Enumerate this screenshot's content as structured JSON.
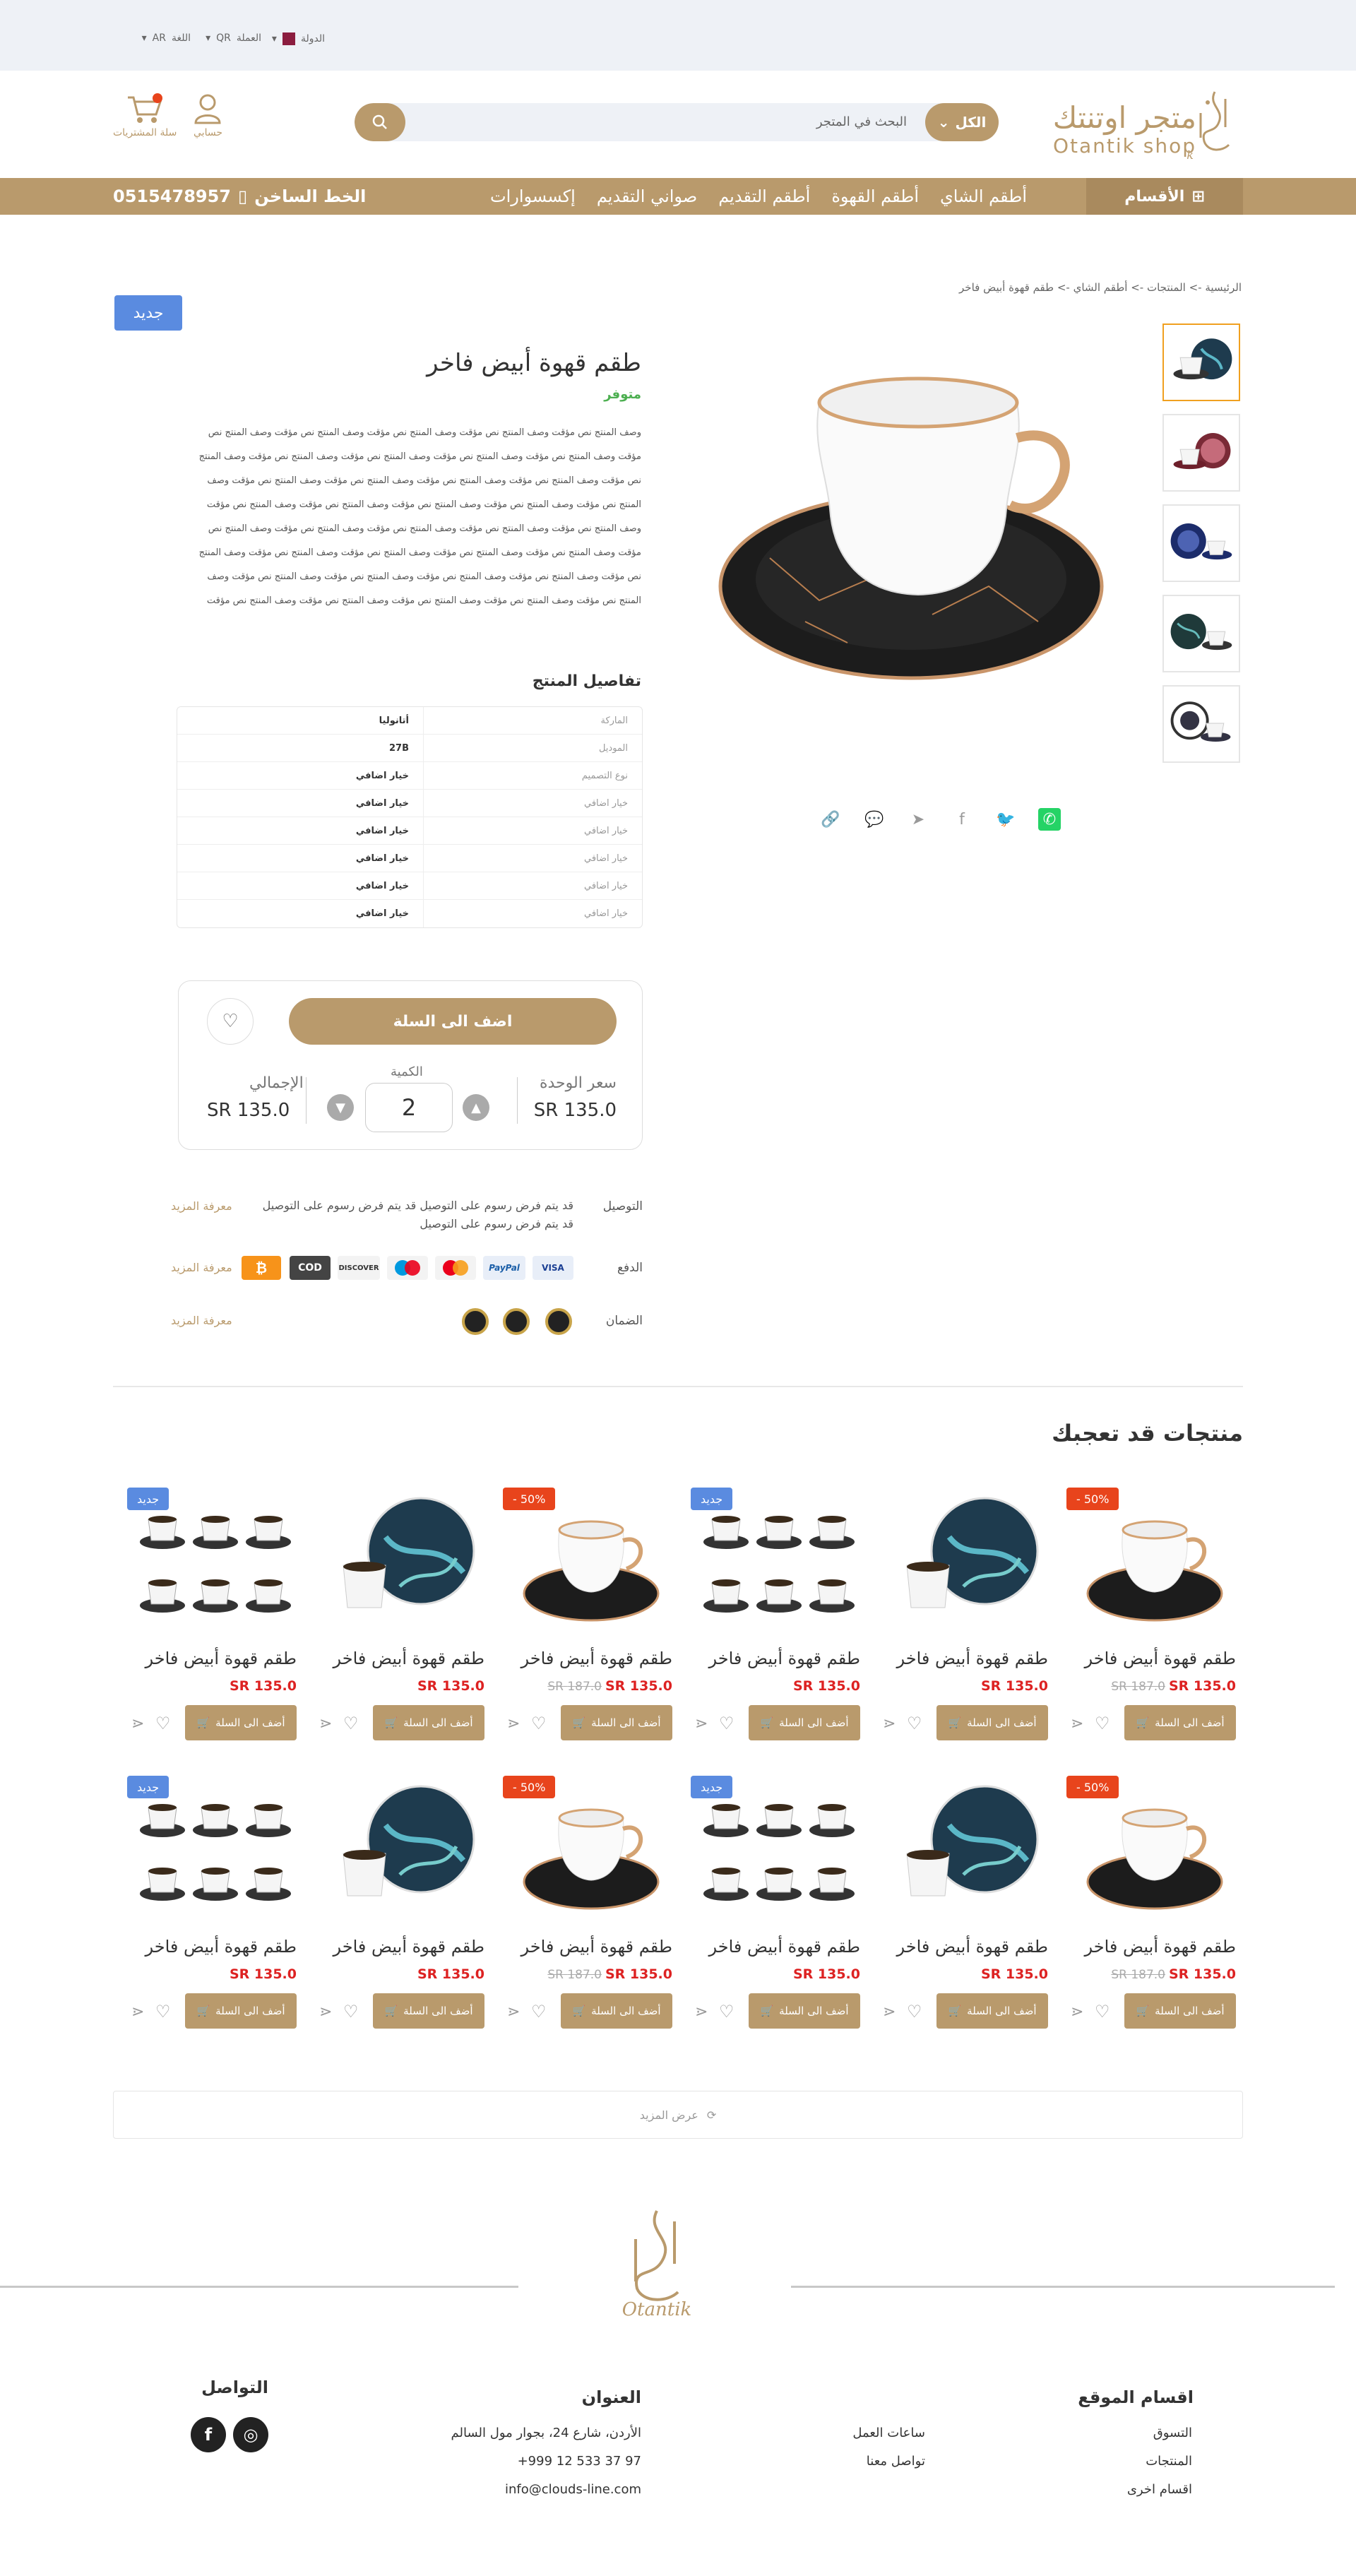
{
  "topbar": {
    "country_label": "الدولة",
    "currency_label": "العملة",
    "currency_value": "QR",
    "language_label": "اللغة",
    "language_value": "AR"
  },
  "header": {
    "logo_ar": "متجر اوتنتك",
    "logo_en": "Otantik shop",
    "search_category": "الكل",
    "search_placeholder": "البحث في المتجر",
    "account_label": "حسابي",
    "cart_label": "سلة المشتريات",
    "cart_count": "0"
  },
  "nav": {
    "categories_label": "الأقسام",
    "links": [
      "أطقم الشاي",
      "أطقم القهوة",
      "أطقم التقديم",
      "صواني التقديم",
      "إكسسوارات"
    ],
    "hotline_label": "الخط الساخن",
    "hotline_number": "0515478957"
  },
  "breadcrumb": "الرئيسية -> المنتجات -> أطقم الشاي -> طقم قهوة أبيض فاخر",
  "product": {
    "badge": "جديد",
    "title": "طقم قهوة أبيض فاخر",
    "availability": "متوفر",
    "description": "وصف المنتج نص مؤقت وصف المنتج نص مؤقت وصف المنتج نص مؤقت وصف المنتج نص مؤقت وصف المنتج نص مؤقت وصف المنتج نص مؤقت وصف المنتج نص مؤقت وصف المنتج نص مؤقت وصف المنتج نص مؤقت وصف المنتج نص مؤقت وصف المنتج نص مؤقت وصف المنتج نص مؤقت وصف المنتج نص مؤقت وصف المنتج نص مؤقت وصف المنتج نص مؤقت وصف المنتج نص مؤقت وصف المنتج نص مؤقت وصف المنتج نص مؤقت وصف المنتج نص مؤقت وصف المنتج نص مؤقت وصف المنتج نص مؤقت وصف المنتج نص مؤقت وصف المنتج نص مؤقت وصف المنتج نص مؤقت وصف المنتج نص مؤقت وصف المنتج نص مؤقت وصف المنتج نص مؤقت وصف المنتج نص مؤقت وصف المنتج نص مؤقت وصف المنتج نص مؤقت وصف المنتج نص مؤقت وصف المنتج نص مؤقت وصف المنتج نص مؤقت وصف المنتج نص مؤقت وصف المنتج نص مؤقت وصف المنتج نص مؤقت وصف المنتج نص مؤقت وصف المنتج نص مؤقت",
    "details_heading": "تفاصيل المنتج",
    "details": [
      {
        "k": "الماركة",
        "v": "أتانوليا"
      },
      {
        "k": "الموديل",
        "v": "27B"
      },
      {
        "k": "نوع التصميم",
        "v": "خيار اضافي"
      },
      {
        "k": "خيار اضافي",
        "v": "خيار اضافي"
      },
      {
        "k": "خيار اضافي",
        "v": "خيار اضافي"
      },
      {
        "k": "خيار اضافي",
        "v": "خيار اضافي"
      },
      {
        "k": "خيار اضافي",
        "v": "خيار اضافي"
      },
      {
        "k": "خيار اضافي",
        "v": "خيار اضافي"
      }
    ],
    "add_to_cart": "اضف الى السلة",
    "unit_price_label": "سعر الوحدة",
    "unit_price": "135.0 SR",
    "quantity_label": "الكمية",
    "quantity": "2",
    "total_label": "الإجمالي",
    "total": "135.0 SR"
  },
  "info": {
    "delivery_label": "التوصيل",
    "delivery_text": "قد يتم فرض رسوم على التوصيل قد يتم فرض رسوم على التوصيل قد يتم فرض رسوم على التوصيل",
    "payment_label": "الدفع",
    "guarantee_label": "الضمان",
    "more_label": "معرفة المزيد",
    "payments": [
      "VISA",
      "PayPal",
      "MasterCard",
      "Maestro",
      "DISCOVER",
      "COD",
      "₿"
    ]
  },
  "related": {
    "heading": "منتجات قد تعجبك",
    "cart_label": "أضف الى السلة",
    "items": [
      {
        "name": "طقم قهوة أبيض فاخر",
        "price": "135.0 SR",
        "old_price": "187.0 SR",
        "badge": "50% -",
        "img": "white"
      },
      {
        "name": "طقم قهوة أبيض فاخر",
        "price": "135.0 SR",
        "old_price": "",
        "badge": "",
        "img": "teal"
      },
      {
        "name": "طقم قهوة أبيض فاخر",
        "price": "135.0 SR",
        "old_price": "",
        "badge": "جديد",
        "img": "set"
      },
      {
        "name": "طقم قهوة أبيض فاخر",
        "price": "135.0 SR",
        "old_price": "187.0 SR",
        "badge": "50% -",
        "img": "white"
      },
      {
        "name": "طقم قهوة أبيض فاخر",
        "price": "135.0 SR",
        "old_price": "",
        "badge": "",
        "img": "teal"
      },
      {
        "name": "طقم قهوة أبيض فاخر",
        "price": "135.0 SR",
        "old_price": "",
        "badge": "جديد",
        "img": "set"
      },
      {
        "name": "طقم قهوة أبيض فاخر",
        "price": "135.0 SR",
        "old_price": "187.0 SR",
        "badge": "50% -",
        "img": "white"
      },
      {
        "name": "طقم قهوة أبيض فاخر",
        "price": "135.0 SR",
        "old_price": "",
        "badge": "",
        "img": "teal"
      },
      {
        "name": "طقم قهوة أبيض فاخر",
        "price": "135.0 SR",
        "old_price": "",
        "badge": "جديد",
        "img": "set"
      },
      {
        "name": "طقم قهوة أبيض فاخر",
        "price": "135.0 SR",
        "old_price": "187.0 SR",
        "badge": "50% -",
        "img": "white"
      },
      {
        "name": "طقم قهوة أبيض فاخر",
        "price": "135.0 SR",
        "old_price": "",
        "badge": "",
        "img": "teal"
      },
      {
        "name": "طقم قهوة أبيض فاخر",
        "price": "135.0 SR",
        "old_price": "",
        "badge": "جديد",
        "img": "set"
      }
    ],
    "show_more": "عرض المزيد"
  },
  "footer": {
    "sections_heading": "اقسام الموقع",
    "sections_col1": [
      "التسوق",
      "المنتجات",
      "اقسام اخرى"
    ],
    "sections_col2": [
      "ساعات العمل",
      "تواصل معنا"
    ],
    "address_heading": "العنوان",
    "address": "الأردن، شارع 24، بجوار مول السالم",
    "phone": "+999 12 533 37 97",
    "email": "info@clouds-line.com",
    "contact_heading": "التواصل",
    "logo_text": "Otantik"
  },
  "colors": {
    "brand": "#b99a6c",
    "sale": "#e8441c",
    "new": "#5a8be0",
    "price": "#dd2222"
  }
}
